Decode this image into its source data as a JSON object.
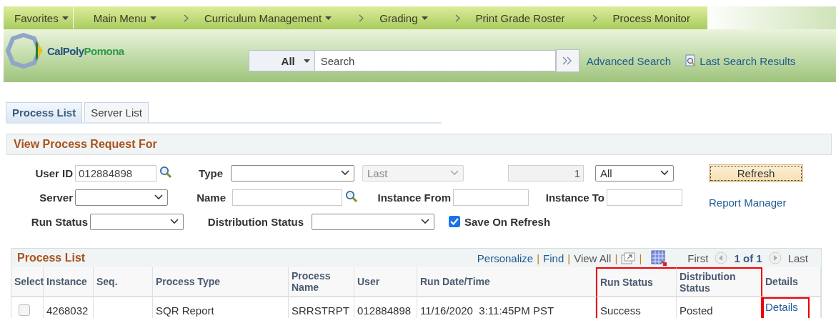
{
  "nav_bar": {
    "items": [
      {
        "label": "Favorites",
        "dropdown": true,
        "chevron_before": false
      },
      {
        "label": "Main Menu",
        "dropdown": true,
        "chevron_before": false
      },
      {
        "label": "Curriculum Management",
        "dropdown": true,
        "chevron_before": true
      },
      {
        "label": "Grading",
        "dropdown": true,
        "chevron_before": true
      },
      {
        "label": "Print Grade Roster",
        "dropdown": false,
        "chevron_before": true
      },
      {
        "label": "Process Monitor",
        "dropdown": false,
        "chevron_before": true
      }
    ]
  },
  "header": {
    "logo_text_1": "CalPoly",
    "logo_text_2": "Pomona",
    "search_scope": "All",
    "search_placeholder": "Search",
    "advanced_search": "Advanced Search",
    "last_search_results": "Last Search Results"
  },
  "tabs": [
    {
      "label": "Process List",
      "selected": true
    },
    {
      "label": "Server List",
      "selected": false
    }
  ],
  "view_section": {
    "title": "View Process Request For",
    "user_id": {
      "label": "User ID",
      "value": "012884898"
    },
    "type": {
      "label": "Type"
    },
    "last": {
      "value": "Last",
      "disabled": true
    },
    "count": {
      "value": "1",
      "disabled": true
    },
    "period": {
      "value": "All"
    },
    "refresh": "Refresh",
    "server": {
      "label": "Server"
    },
    "name": {
      "label": "Name"
    },
    "instance_from": {
      "label": "Instance From"
    },
    "instance_to": {
      "label": "Instance To"
    },
    "report_manager": "Report Manager",
    "run_status": {
      "label": "Run Status"
    },
    "distribution_status": {
      "label": "Distribution Status"
    },
    "save_on_refresh": {
      "label": "Save On Refresh",
      "checked": true
    }
  },
  "process_list": {
    "title": "Process List",
    "toolbar": {
      "personalize": "Personalize",
      "separator_1": "|",
      "find": "Find",
      "separator_2": "|",
      "view_all": "View All",
      "separator_3": "|",
      "separator_4": "|",
      "first": "First",
      "range": "1 of 1",
      "last": "Last"
    },
    "columns": [
      {
        "label": "Select",
        "highlighted": false
      },
      {
        "label": "Instance",
        "highlighted": false
      },
      {
        "label": "Seq.",
        "highlighted": false
      },
      {
        "label": "Process Type",
        "highlighted": false
      },
      {
        "label": "Process Name",
        "highlighted": false
      },
      {
        "label": "User",
        "highlighted": false
      },
      {
        "label": "Run Date/Time",
        "highlighted": false
      },
      {
        "label": "Run Status",
        "highlighted": true
      },
      {
        "label": "Distribution Status",
        "highlighted": true
      },
      {
        "label": "Details",
        "highlighted": false
      }
    ],
    "rows": [
      {
        "cells": [
          {
            "kind": "checkbox",
            "checked": false
          },
          {
            "text": "4268032"
          },
          {
            "text": ""
          },
          {
            "text": "SQR Report"
          },
          {
            "text": "SRRSTRPT"
          },
          {
            "text": "012884898"
          },
          {
            "text": "11/16/2020  3:11:45PM PST"
          },
          {
            "text": "Success"
          },
          {
            "text": "Posted"
          },
          {
            "text": "Details",
            "highlighted": true,
            "kind": "link"
          }
        ]
      }
    ]
  }
}
